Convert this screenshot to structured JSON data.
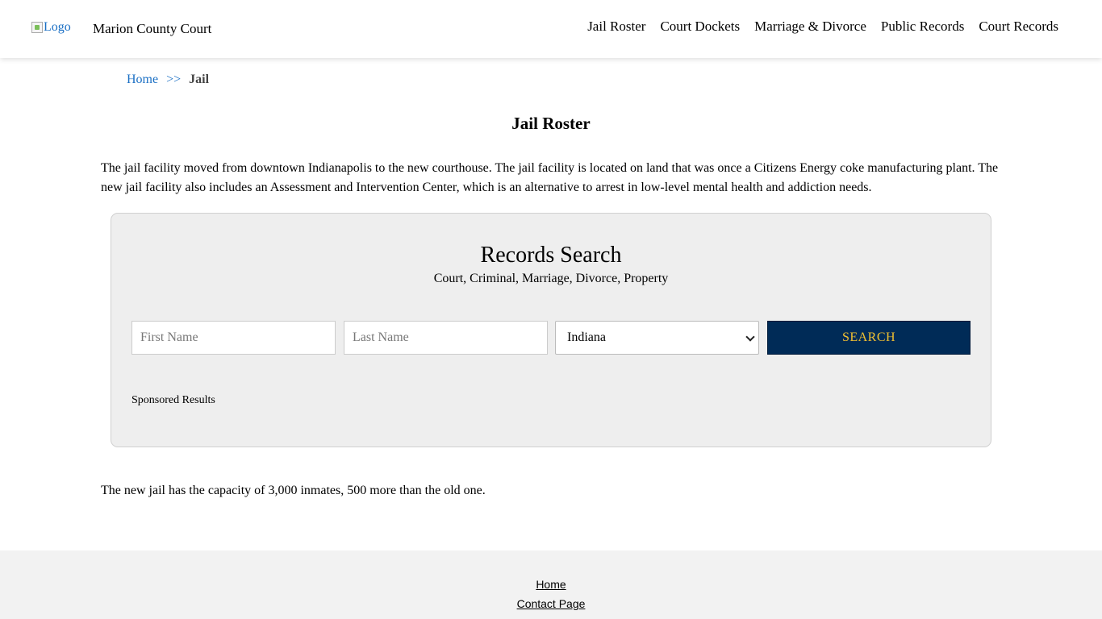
{
  "header": {
    "logo_alt": "Logo",
    "site_name": "Marion County Court",
    "nav": [
      "Jail Roster",
      "Court Dockets",
      "Marriage & Divorce",
      "Public Records",
      "Court Records"
    ]
  },
  "breadcrumb": {
    "home": "Home",
    "separator": ">>",
    "current": "Jail"
  },
  "page": {
    "title": "Jail Roster",
    "intro": "The jail facility moved from downtown Indianapolis to the new courthouse. The jail facility is located on land that was once a Citizens Energy coke manufacturing plant. The new jail facility also includes an Assessment and Intervention Center, which is an alternative to arrest in low-level mental health and addiction needs.",
    "capacity_text": "The new jail has the capacity of 3,000 inmates, 500 more than the old one."
  },
  "search": {
    "title": "Records Search",
    "subtitle": "Court, Criminal, Marriage, Divorce, Property",
    "first_name_placeholder": "First Name",
    "last_name_placeholder": "Last Name",
    "state_selected": "Indiana",
    "button_label": "SEARCH",
    "sponsored_label": "Sponsored Results"
  },
  "footer": {
    "links": [
      "Home",
      "Contact Page"
    ]
  },
  "colors": {
    "button_bg": "#002b57",
    "button_text": "#f2c230",
    "link": "#1a6fc4",
    "search_box_bg": "#eeeeee",
    "footer_bg": "#f2f2f2"
  }
}
